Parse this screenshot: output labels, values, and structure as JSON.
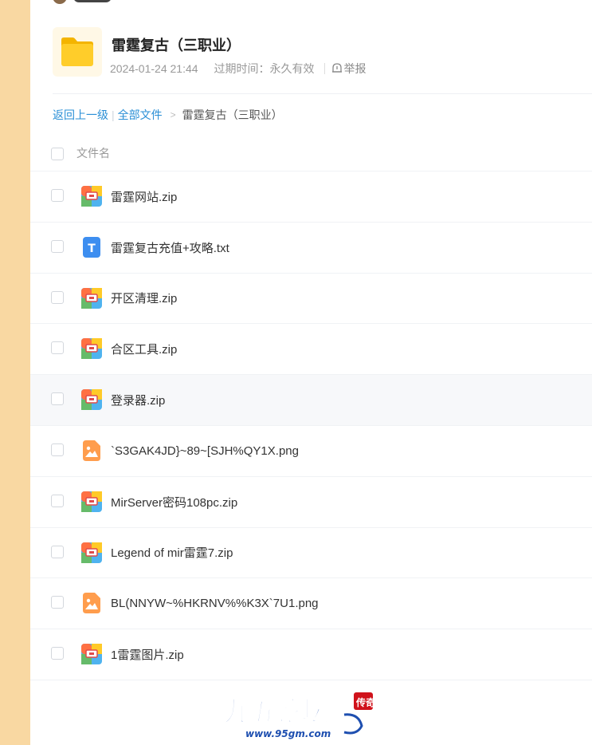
{
  "share": {
    "title": "雷霆复古（三职业）",
    "date": "2024-01-24 21:44",
    "expiry": "过期时间：永久有效",
    "report": "举报"
  },
  "breadcrumb": {
    "back": "返回上一级",
    "all": "全部文件",
    "current": "雷霆复古（三职业）"
  },
  "list": {
    "column_name": "文件名",
    "files": [
      {
        "name": "雷霆网站.zip",
        "type": "zip"
      },
      {
        "name": "雷霆复古充值+攻略.txt",
        "type": "txt"
      },
      {
        "name": "开区清理.zip",
        "type": "zip"
      },
      {
        "name": "合区工具.zip",
        "type": "zip"
      },
      {
        "name": "登录器.zip",
        "type": "zip"
      },
      {
        "name": "`S3GAK4JD}~89~[SJH%QY1X.png",
        "type": "image"
      },
      {
        "name": "MirServer密码108pc.zip",
        "type": "zip"
      },
      {
        "name": "Legend of mir雷霆7.zip",
        "type": "zip"
      },
      {
        "name": "BL(NNYW~%HKRNV%%K3X`7U1.png",
        "type": "image"
      },
      {
        "name": "1雷霆图片.zip",
        "type": "zip"
      }
    ]
  },
  "watermark": {
    "name": "九五论坛",
    "url": "www.95gm.com",
    "stamp": "传奇"
  },
  "colors": {
    "link": "#2a8fd6",
    "left_strip": "#f9d8a2"
  }
}
